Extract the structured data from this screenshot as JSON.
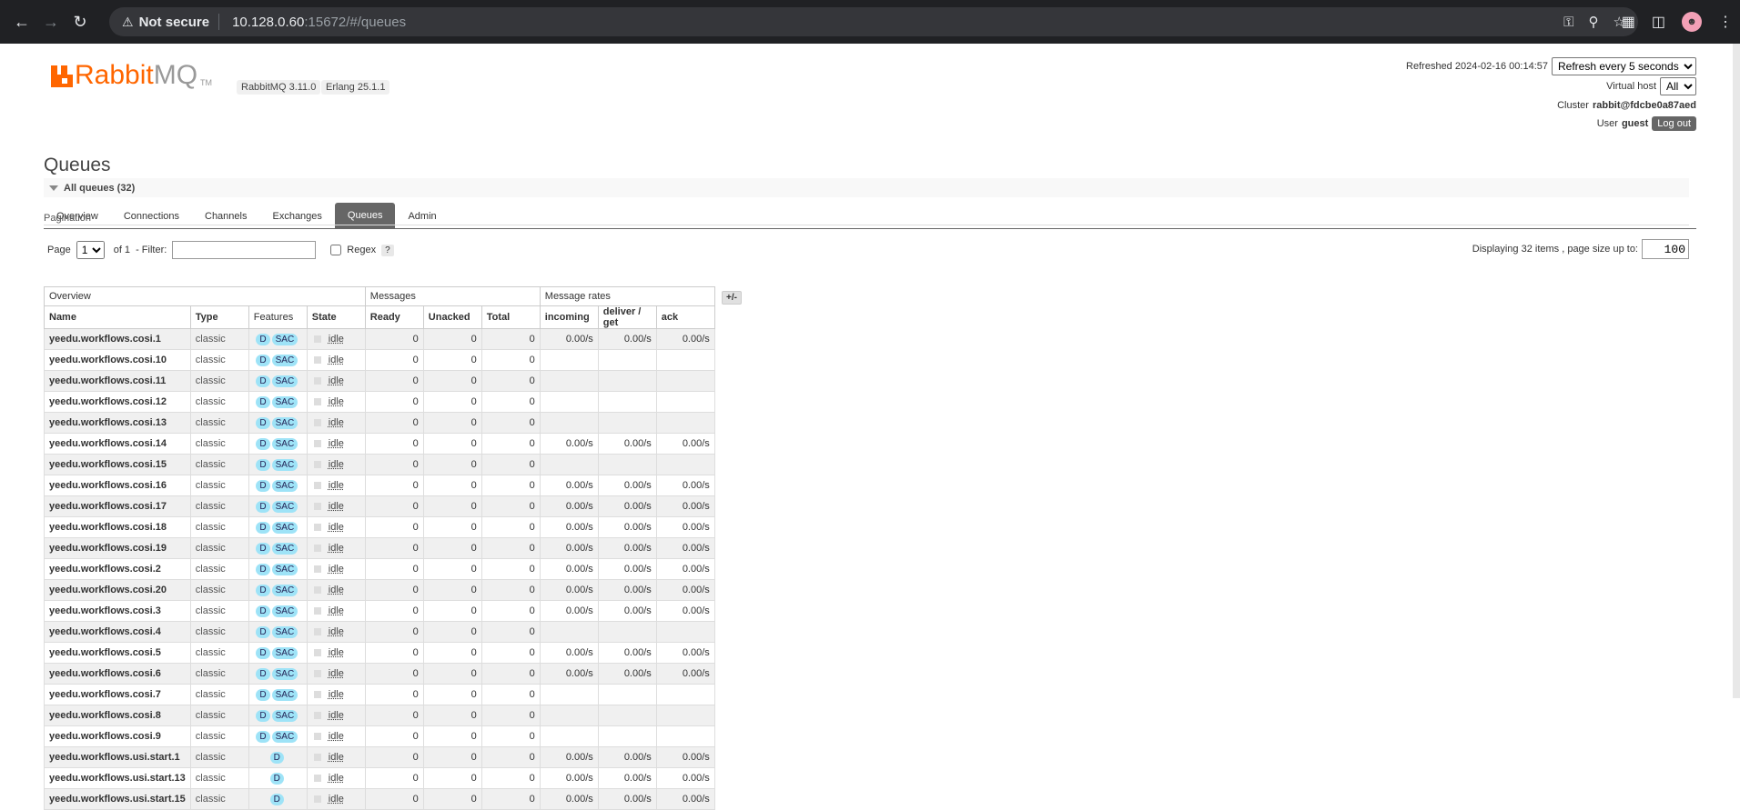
{
  "browser": {
    "security_warning": "Not secure",
    "url_host": "10.128.0.60",
    "url_rest": ":15672/#/queues"
  },
  "app": {
    "logo_text_a": "Rabbit",
    "logo_text_b": "MQ",
    "logo_tm": "TM",
    "version": "RabbitMQ 3.11.0",
    "erlang": "Erlang 25.1.1"
  },
  "header": {
    "refreshed_label": "Refreshed 2024-02-16 00:14:57",
    "refresh_select": "Refresh every 5 seconds",
    "vhost_label": "Virtual host",
    "vhost_select": "All",
    "cluster_label": "Cluster",
    "cluster_name": "rabbit@fdcbe0a87aed",
    "user_label": "User",
    "user_name": "guest",
    "logout": "Log out"
  },
  "tabs": [
    "Overview",
    "Connections",
    "Channels",
    "Exchanges",
    "Queues",
    "Admin"
  ],
  "active_tab": "Queues",
  "page_title": "Queues",
  "section_title": "All queues (32)",
  "pagination": {
    "label": "Pagination",
    "page_label": "Page",
    "page_value": "1",
    "of_label": "of 1",
    "filter_label": "- Filter:",
    "filter_value": "",
    "regex_label": "Regex",
    "help": "?",
    "display_info": "Displaying 32 items , page size up to:",
    "page_size": "100"
  },
  "table": {
    "group_headers": [
      "Overview",
      "Messages",
      "Message rates"
    ],
    "columns": [
      "Name",
      "Type",
      "Features",
      "State",
      "Ready",
      "Unacked",
      "Total",
      "incoming",
      "deliver / get",
      "ack"
    ],
    "toggle": "+/-",
    "rows": [
      {
        "name": "yeedu.workflows.cosi.1",
        "type": "classic",
        "features": [
          "D",
          "SAC"
        ],
        "state": "idle",
        "ready": "0",
        "unacked": "0",
        "total": "0",
        "incoming": "0.00/s",
        "deliver": "0.00/s",
        "ack": "0.00/s"
      },
      {
        "name": "yeedu.workflows.cosi.10",
        "type": "classic",
        "features": [
          "D",
          "SAC"
        ],
        "state": "idle",
        "ready": "0",
        "unacked": "0",
        "total": "0",
        "incoming": "",
        "deliver": "",
        "ack": ""
      },
      {
        "name": "yeedu.workflows.cosi.11",
        "type": "classic",
        "features": [
          "D",
          "SAC"
        ],
        "state": "idle",
        "ready": "0",
        "unacked": "0",
        "total": "0",
        "incoming": "",
        "deliver": "",
        "ack": ""
      },
      {
        "name": "yeedu.workflows.cosi.12",
        "type": "classic",
        "features": [
          "D",
          "SAC"
        ],
        "state": "idle",
        "ready": "0",
        "unacked": "0",
        "total": "0",
        "incoming": "",
        "deliver": "",
        "ack": ""
      },
      {
        "name": "yeedu.workflows.cosi.13",
        "type": "classic",
        "features": [
          "D",
          "SAC"
        ],
        "state": "idle",
        "ready": "0",
        "unacked": "0",
        "total": "0",
        "incoming": "",
        "deliver": "",
        "ack": ""
      },
      {
        "name": "yeedu.workflows.cosi.14",
        "type": "classic",
        "features": [
          "D",
          "SAC"
        ],
        "state": "idle",
        "ready": "0",
        "unacked": "0",
        "total": "0",
        "incoming": "0.00/s",
        "deliver": "0.00/s",
        "ack": "0.00/s"
      },
      {
        "name": "yeedu.workflows.cosi.15",
        "type": "classic",
        "features": [
          "D",
          "SAC"
        ],
        "state": "idle",
        "ready": "0",
        "unacked": "0",
        "total": "0",
        "incoming": "",
        "deliver": "",
        "ack": ""
      },
      {
        "name": "yeedu.workflows.cosi.16",
        "type": "classic",
        "features": [
          "D",
          "SAC"
        ],
        "state": "idle",
        "ready": "0",
        "unacked": "0",
        "total": "0",
        "incoming": "0.00/s",
        "deliver": "0.00/s",
        "ack": "0.00/s"
      },
      {
        "name": "yeedu.workflows.cosi.17",
        "type": "classic",
        "features": [
          "D",
          "SAC"
        ],
        "state": "idle",
        "ready": "0",
        "unacked": "0",
        "total": "0",
        "incoming": "0.00/s",
        "deliver": "0.00/s",
        "ack": "0.00/s"
      },
      {
        "name": "yeedu.workflows.cosi.18",
        "type": "classic",
        "features": [
          "D",
          "SAC"
        ],
        "state": "idle",
        "ready": "0",
        "unacked": "0",
        "total": "0",
        "incoming": "0.00/s",
        "deliver": "0.00/s",
        "ack": "0.00/s"
      },
      {
        "name": "yeedu.workflows.cosi.19",
        "type": "classic",
        "features": [
          "D",
          "SAC"
        ],
        "state": "idle",
        "ready": "0",
        "unacked": "0",
        "total": "0",
        "incoming": "0.00/s",
        "deliver": "0.00/s",
        "ack": "0.00/s"
      },
      {
        "name": "yeedu.workflows.cosi.2",
        "type": "classic",
        "features": [
          "D",
          "SAC"
        ],
        "state": "idle",
        "ready": "0",
        "unacked": "0",
        "total": "0",
        "incoming": "0.00/s",
        "deliver": "0.00/s",
        "ack": "0.00/s"
      },
      {
        "name": "yeedu.workflows.cosi.20",
        "type": "classic",
        "features": [
          "D",
          "SAC"
        ],
        "state": "idle",
        "ready": "0",
        "unacked": "0",
        "total": "0",
        "incoming": "0.00/s",
        "deliver": "0.00/s",
        "ack": "0.00/s"
      },
      {
        "name": "yeedu.workflows.cosi.3",
        "type": "classic",
        "features": [
          "D",
          "SAC"
        ],
        "state": "idle",
        "ready": "0",
        "unacked": "0",
        "total": "0",
        "incoming": "0.00/s",
        "deliver": "0.00/s",
        "ack": "0.00/s"
      },
      {
        "name": "yeedu.workflows.cosi.4",
        "type": "classic",
        "features": [
          "D",
          "SAC"
        ],
        "state": "idle",
        "ready": "0",
        "unacked": "0",
        "total": "0",
        "incoming": "",
        "deliver": "",
        "ack": ""
      },
      {
        "name": "yeedu.workflows.cosi.5",
        "type": "classic",
        "features": [
          "D",
          "SAC"
        ],
        "state": "idle",
        "ready": "0",
        "unacked": "0",
        "total": "0",
        "incoming": "0.00/s",
        "deliver": "0.00/s",
        "ack": "0.00/s"
      },
      {
        "name": "yeedu.workflows.cosi.6",
        "type": "classic",
        "features": [
          "D",
          "SAC"
        ],
        "state": "idle",
        "ready": "0",
        "unacked": "0",
        "total": "0",
        "incoming": "0.00/s",
        "deliver": "0.00/s",
        "ack": "0.00/s"
      },
      {
        "name": "yeedu.workflows.cosi.7",
        "type": "classic",
        "features": [
          "D",
          "SAC"
        ],
        "state": "idle",
        "ready": "0",
        "unacked": "0",
        "total": "0",
        "incoming": "",
        "deliver": "",
        "ack": ""
      },
      {
        "name": "yeedu.workflows.cosi.8",
        "type": "classic",
        "features": [
          "D",
          "SAC"
        ],
        "state": "idle",
        "ready": "0",
        "unacked": "0",
        "total": "0",
        "incoming": "",
        "deliver": "",
        "ack": ""
      },
      {
        "name": "yeedu.workflows.cosi.9",
        "type": "classic",
        "features": [
          "D",
          "SAC"
        ],
        "state": "idle",
        "ready": "0",
        "unacked": "0",
        "total": "0",
        "incoming": "",
        "deliver": "",
        "ack": ""
      },
      {
        "name": "yeedu.workflows.usi.start.1",
        "type": "classic",
        "features": [
          "D"
        ],
        "state": "idle",
        "ready": "0",
        "unacked": "0",
        "total": "0",
        "incoming": "0.00/s",
        "deliver": "0.00/s",
        "ack": "0.00/s"
      },
      {
        "name": "yeedu.workflows.usi.start.13",
        "type": "classic",
        "features": [
          "D"
        ],
        "state": "idle",
        "ready": "0",
        "unacked": "0",
        "total": "0",
        "incoming": "0.00/s",
        "deliver": "0.00/s",
        "ack": "0.00/s"
      },
      {
        "name": "yeedu.workflows.usi.start.15",
        "type": "classic",
        "features": [
          "D"
        ],
        "state": "idle",
        "ready": "0",
        "unacked": "0",
        "total": "0",
        "incoming": "0.00/s",
        "deliver": "0.00/s",
        "ack": "0.00/s"
      }
    ]
  },
  "colors": {
    "brand_orange": "#ff6600",
    "badge": "#9ee3f7",
    "tab_active": "#666666"
  },
  "icons": {
    "back": "back-arrow-icon",
    "forward": "forward-arrow-icon",
    "reload": "reload-icon",
    "warning": "warning-triangle-icon",
    "key": "key-icon",
    "zoom": "zoom-icon",
    "star": "star-icon",
    "extensions": "puzzle-icon",
    "sidepanel": "side-panel-icon",
    "menu": "kebab-menu-icon"
  }
}
